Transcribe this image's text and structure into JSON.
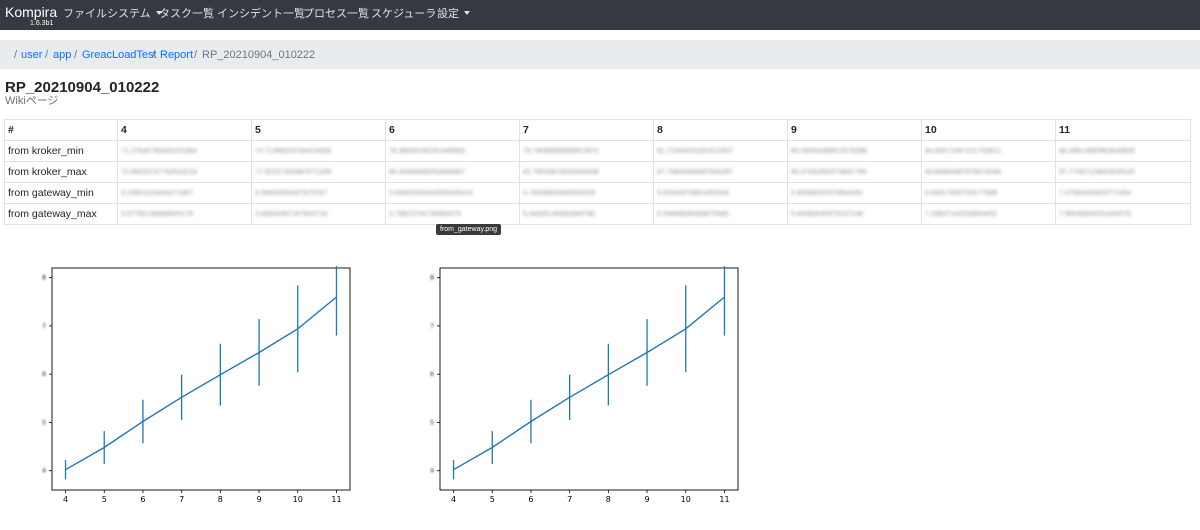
{
  "navbar": {
    "brand": "Kompira",
    "version": "1.6.3b1",
    "items": [
      {
        "label": "ファイルシステム",
        "dropdown": true
      },
      {
        "label": "タスク一覧",
        "dropdown": false
      },
      {
        "label": "インシデント一覧",
        "dropdown": false
      },
      {
        "label": "プロセス一覧",
        "dropdown": false
      },
      {
        "label": "スケジューラ",
        "dropdown": false
      },
      {
        "label": "設定",
        "dropdown": true
      }
    ]
  },
  "breadcrumb": {
    "separator": "/",
    "items": [
      "user",
      "app",
      "GreacLoadTest",
      "Report",
      "RP_20210904_010222"
    ]
  },
  "page": {
    "title": "RP_20210904_010222",
    "subtitle": "Wikiページ"
  },
  "table": {
    "header": [
      "#",
      "4",
      "5",
      "6",
      "7",
      "8",
      "9",
      "10",
      "11"
    ],
    "rows": [
      {
        "label": "from kroker_min",
        "values": [
          "71.27646780405231864",
          "74.71396023764416808",
          "76.98049165291945883",
          "78.79598806085813872",
          "81.72454016281913307",
          "83.33054469812076398",
          "84.84571667101753812",
          "86.09613860963849835"
        ]
      },
      {
        "label": "from kroker_max",
        "values": [
          "72.66023747762524218",
          "77.52227345987071209",
          "80.44388680054965867",
          "82.76539878535944436",
          "87.79604069897064287",
          "90.47092892579687785",
          "93.86864987876674546",
          "97.77497129653928105"
        ]
      },
      {
        "label": "from gateway_min",
        "values": [
          "3.24961024444271667",
          "3.59643563407676787",
          "3.84603264944595646414",
          "4.75048963465943209",
          "5.02844978862453344",
          "5.86389192374664082",
          "6.89317892703177989",
          "7.07884405403771464"
        ]
      },
      {
        "label": "from gateway_max",
        "values": [
          "3.67792136868005176",
          "3.88924397167603716",
          "4.79823744726560376",
          "5.04335135683364796",
          "5.53948946458875392",
          "5.94380640375237148",
          "7.29637142528694452",
          "7.90539654251630576"
        ]
      }
    ]
  },
  "tooltip": "from_gateway.png",
  "chart_data": [
    {
      "type": "line",
      "title": "",
      "xlabel": "",
      "ylabel": "",
      "x": [
        4,
        5,
        6,
        7,
        8,
        9,
        10,
        11
      ],
      "xticks": [
        "4",
        "5",
        "6",
        "7",
        "8",
        "9",
        "10",
        "11"
      ],
      "y": [
        4.02,
        4.48,
        5.02,
        5.52,
        5.99,
        6.45,
        6.94,
        7.6
      ],
      "yerr": [
        0.2,
        0.34,
        0.45,
        0.47,
        0.64,
        0.69,
        0.9,
        0.8
      ],
      "yticks": [
        "4",
        "5",
        "6",
        "7",
        "8"
      ],
      "ylim": [
        3.6,
        8.2
      ],
      "xlim": [
        3.65,
        11.35
      ],
      "color": "#1f77b4"
    },
    {
      "type": "line",
      "title": "",
      "xlabel": "",
      "ylabel": "",
      "x": [
        4,
        5,
        6,
        7,
        8,
        9,
        10,
        11
      ],
      "xticks": [
        "4",
        "5",
        "6",
        "7",
        "8",
        "9",
        "10",
        "11"
      ],
      "y": [
        4.02,
        4.48,
        5.02,
        5.52,
        5.99,
        6.45,
        6.94,
        7.6
      ],
      "yerr": [
        0.2,
        0.34,
        0.45,
        0.47,
        0.64,
        0.69,
        0.9,
        0.8
      ],
      "yticks": [
        "4",
        "5",
        "6",
        "7",
        "8"
      ],
      "ylim": [
        3.6,
        8.2
      ],
      "xlim": [
        3.65,
        11.35
      ],
      "color": "#1f77b4"
    }
  ]
}
